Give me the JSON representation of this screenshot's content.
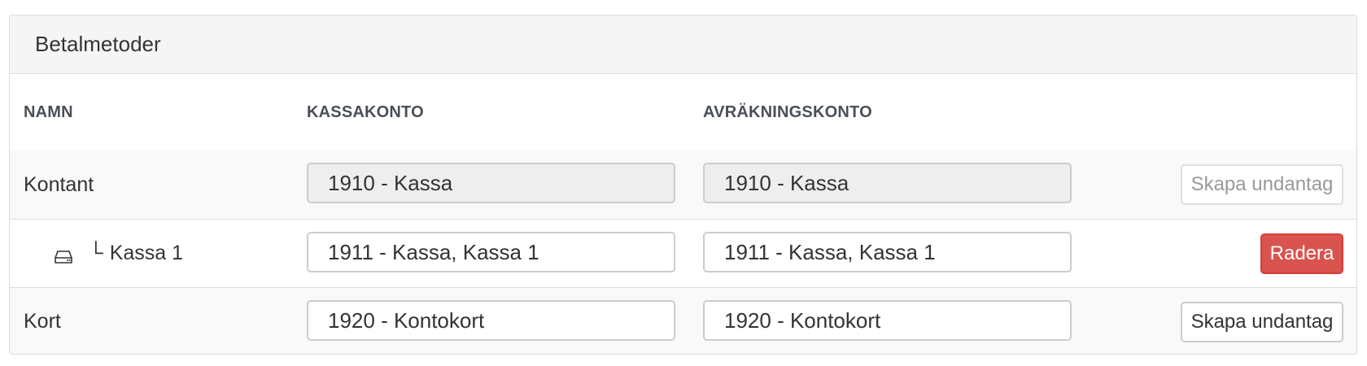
{
  "panel": {
    "title": "Betalmetoder"
  },
  "table": {
    "headers": {
      "name": "NAMN",
      "cash_account": "KASSAKONTO",
      "settlement_account": "AVRÄKNINGSKONTO"
    },
    "rows": [
      {
        "name": "Kontant",
        "cash_account": "1910 - Kassa",
        "settlement_account": "1910 - Kassa",
        "action": "Skapa undantag"
      },
      {
        "tree_glyph": "└",
        "name": "Kassa 1",
        "cash_account": "1911 - Kassa, Kassa 1",
        "settlement_account": "1911 - Kassa, Kassa 1",
        "action": "Radera"
      },
      {
        "name": "Kort",
        "cash_account": "1920 - Kontokort",
        "settlement_account": "1920 - Kontokort",
        "action": "Skapa undantag"
      }
    ]
  },
  "colors": {
    "danger": "#d9534f",
    "header_text": "#4a4f57",
    "panel_heading_bg": "#f5f5f5",
    "readonly_bg": "#eeeeee"
  },
  "icons": {
    "sub_row": "hard-drive-icon"
  }
}
